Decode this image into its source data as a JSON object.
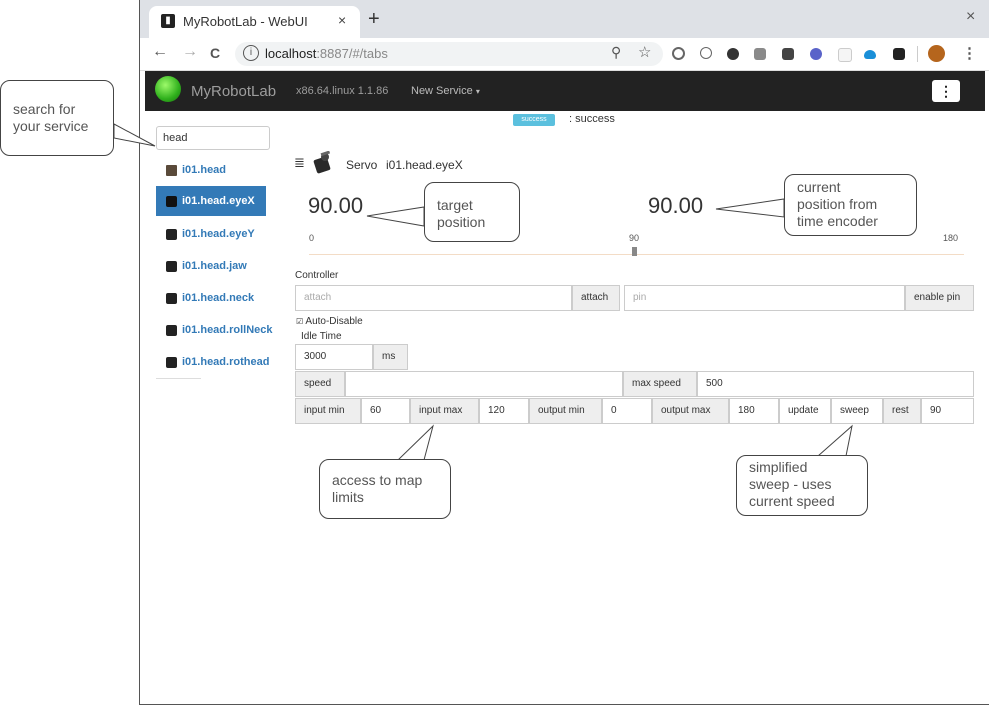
{
  "browser": {
    "tab_title": "MyRobotLab - WebUI",
    "tab_close": "×",
    "new_tab": "+",
    "window_close": "×",
    "back": "←",
    "forward": "→",
    "reload": "C",
    "info_glyph": "i",
    "url_host": "localhost",
    "url_rest": ":8887/#/tabs",
    "zoom_glyph": "⚲",
    "star_glyph": "☆",
    "menu_glyph": "⋮"
  },
  "navbar": {
    "brand": "MyRobotLab",
    "platform": "x86.64.linux 1.1.86",
    "new_service": "New Service",
    "menu_glyph": "⋮"
  },
  "status": {
    "badge": "success",
    "text": ": success"
  },
  "sidebar": {
    "search_value": "head",
    "items": [
      {
        "label": "i01.head",
        "active": false
      },
      {
        "label": "i01.head.eyeX",
        "active": true
      },
      {
        "label": "i01.head.eyeY",
        "active": false
      },
      {
        "label": "i01.head.jaw",
        "active": false
      },
      {
        "label": "i01.head.neck",
        "active": false
      },
      {
        "label": "i01.head.rollNeck",
        "active": false
      },
      {
        "label": "i01.head.rothead",
        "active": false
      }
    ]
  },
  "servo": {
    "type": "Servo",
    "name": "i01.head.eyeX",
    "target": "90.00",
    "current": "90.00",
    "slider": {
      "min": "0",
      "mid": "90",
      "max": "180",
      "value": 90
    },
    "controller_label": "Controller",
    "attach_placeholder": "attach",
    "attach_button": "attach",
    "pin_placeholder": "pin",
    "enable_pin_button": "enable pin",
    "auto_disable": "Auto-Disable",
    "auto_disable_checked": true,
    "idle_time_label": "Idle Time",
    "idle_time": "3000",
    "idle_unit": "ms",
    "speed_label": "speed",
    "speed_value": "",
    "max_speed_label": "max speed",
    "max_speed_value": "500",
    "input_min_label": "input min",
    "input_min": "60",
    "input_max_label": "input max",
    "input_max": "120",
    "output_min_label": "output min",
    "output_min": "0",
    "output_max_label": "output max",
    "output_max": "180",
    "update_button": "update",
    "sweep_button": "sweep",
    "rest_label": "rest",
    "rest_value": "90"
  },
  "annotations": {
    "search_l1": "search for",
    "search_l2": "your service",
    "target_l1": "target",
    "target_l2": "position",
    "current_l1": "current",
    "current_l2": "position from",
    "current_l3": "time encoder",
    "map_l1": "access to map",
    "map_l2": "limits",
    "sweep_l1": "simplified",
    "sweep_l2": "sweep - uses",
    "sweep_l3": "current speed"
  },
  "colors": {
    "accent": "#337ab7",
    "navbar": "#222222",
    "badge": "#5bc0de"
  }
}
